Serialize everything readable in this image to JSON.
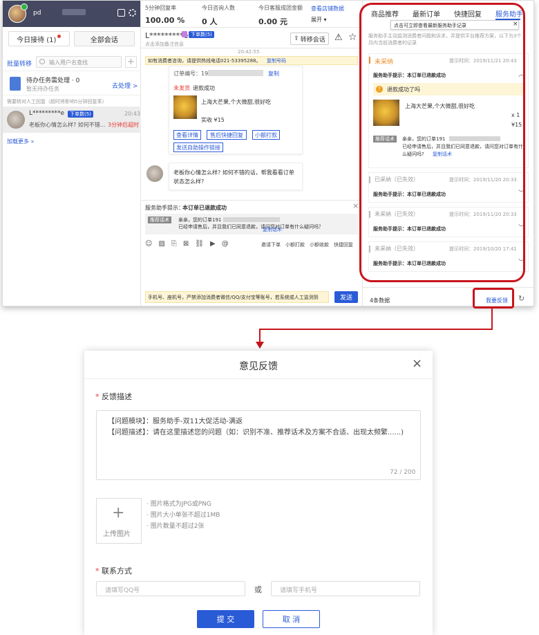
{
  "left": {
    "user": "pd",
    "tabs": [
      "今日接待 (1)",
      "全部会话"
    ],
    "batch_transfer": "批量转移",
    "search_placeholder": "输入用户名查找",
    "todo_title": "待办任务需处理 · 0",
    "todo_sub": "暂无待办任务",
    "todo_link": "去处理 >",
    "hint": "需要转对人工回复（超时将影响5分钟回复率）",
    "session": {
      "name": "L*********e",
      "tag": "下单数(5)",
      "time": "20:43",
      "msg": "老板你心情怎么样? 如何不错...",
      "warn": "3分钟后超时"
    },
    "load_more": "加载更多 »"
  },
  "stats": [
    {
      "label": "5分钟回复率",
      "value": "100.00 %"
    },
    {
      "label": "今日咨询人数",
      "value": "0 人"
    },
    {
      "label": "今日客服成团金额",
      "value": "0.00 元"
    }
  ],
  "store_data": {
    "title": "查看店铺数据",
    "sub": "展开 ▾"
  },
  "chat": {
    "name": "L*********e",
    "tag": "下单数(5)",
    "sub": "点击添加备注信息",
    "transfer": "转移会话",
    "time": "20:42:55",
    "notice": "如有消费者咨询，请提供热线电话021-53395288。",
    "copy_number": "复制号码",
    "order_no_label": "订单编号：1910",
    "copy": "复制",
    "status_tag": "未发货",
    "status": "退款成功",
    "product": "上海大芒果,个大微甜,很好吃",
    "paid": "实收 ¥15",
    "actions": [
      "查看详情",
      "售后快捷回复",
      "小额打款",
      "发送自助操作链接"
    ],
    "question": "老板你心情怎么样? 如何不错的话，帮我看看订单状态怎么样?",
    "assistant_tip": "服务助手提示：",
    "assistant_tip_val": "本订单已退款成功",
    "recommend_tag": "推荐话术",
    "recommend_text": "亲亲，您的订单191",
    "recommend_text2": "已经申请售后，并且我们已同意退款，请问您对订单有什么疑问吗？",
    "copy_speech": "复制话术",
    "tool_links": [
      "邀请下单",
      "小额打款",
      "小额收款",
      "快捷回复"
    ],
    "input_warning": "手机号、座机号，严禁添加消费者微信/QQ/支付宝等账号，若系统或人工监测到",
    "send": "发送"
  },
  "right": {
    "tabs": [
      "商品推荐",
      "最新订单",
      "快捷回复",
      "服务助手"
    ],
    "tooltip": "点击可立即查看最新服务助手记录",
    "intro": "服务助手主动监测消费者问题和诉求，并提供平台推荐方案，以下为3个月内当前消费者的记录",
    "items": [
      {
        "status": "未采纳",
        "time": "提示时间：2019/11/21 20:43",
        "title": "服务助手提示：本订单已退款成功"
      },
      {
        "status": "已采纳（已失效）",
        "time": "提示时间：2019/11/20 20:33",
        "title": "服务助手提示：本订单已退款成功"
      },
      {
        "status": "未采纳（已失效）",
        "time": "提示时间：2019/11/20 20:33",
        "title": "服务助手提示：本订单已退款成功"
      },
      {
        "status": "未采纳（已失效）",
        "time": "提示时间：2019/10/20 17:41",
        "title": "服务助手提示：本订单已退款成功"
      }
    ],
    "alert": "退款成功了吗",
    "product": "上海大芒果,个大微甜,很好吃",
    "qty": "x 1",
    "price": "¥15",
    "rec_tag": "推荐话术",
    "rec_text": "亲亲，您的订单191",
    "rec_text2": "已经申请售后，并且我们已同意退款，请问您对订单有什么疑问吗?",
    "rec_copy": "复制话术",
    "count": "4条数据",
    "feedback": "我要反馈"
  },
  "modal": {
    "title": "意见反馈",
    "desc_label": "反馈描述",
    "desc_line1": "【问题模块】：服务助手-双11大促活动-满返",
    "desc_line2": "【问题描述】：请在这里描述您的问题（如：识别不准、推荐话术及方案不合适、出现太频繁......)",
    "counter": "72 / 200",
    "upload": "上传图片",
    "rules": [
      "图片格式为JPG或PNG",
      "图片大小单张不超过1MB",
      "图片数量不超过2张"
    ],
    "contact_label": "联系方式",
    "qq_placeholder": "请填写QQ号",
    "or": "或",
    "phone_placeholder": "请填写手机号",
    "submit": "提 交",
    "cancel": "取 消"
  }
}
